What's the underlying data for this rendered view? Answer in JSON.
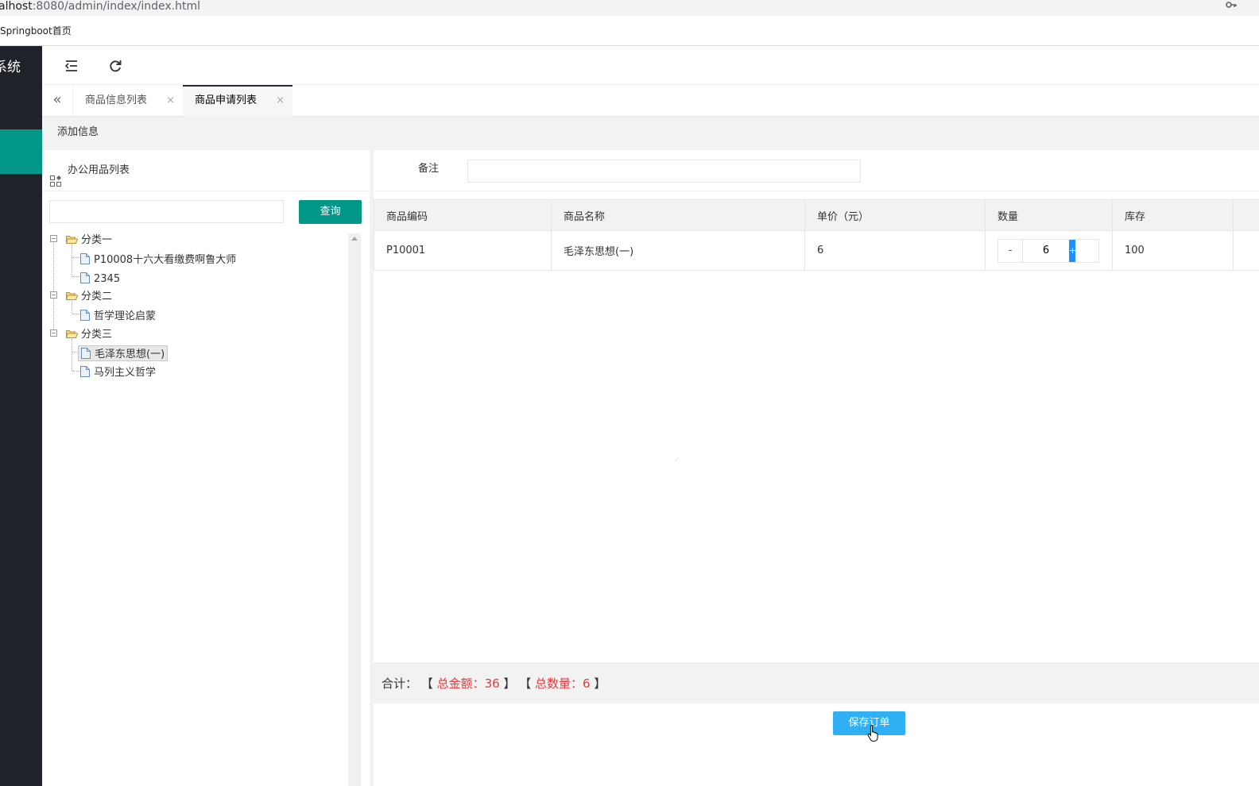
{
  "browser": {
    "url_host": "alhost",
    "url_rest": ":8080/admin/index/index.html",
    "bookmark": "Springboot首页"
  },
  "sidebar": {
    "logo_text": "系统"
  },
  "tabs": [
    {
      "label": "商品信息列表",
      "close": "×"
    },
    {
      "label": "商品申请列表",
      "close": "×"
    }
  ],
  "toolbar": {
    "add_label": "添加信息"
  },
  "left_panel": {
    "title": "办公用品列表",
    "search_placeholder": "",
    "search_button": "查询",
    "tree": [
      {
        "label": "分类一",
        "children": [
          "P10008十六大看缴费啊鲁大师",
          "2345"
        ]
      },
      {
        "label": "分类二",
        "children": [
          "哲学理论启蒙"
        ]
      },
      {
        "label": "分类三",
        "children": [
          "毛泽东思想(一)",
          "马列主义哲学"
        ]
      }
    ]
  },
  "form": {
    "remark_label": "备注",
    "remark_value": ""
  },
  "table": {
    "headers": [
      "商品编码",
      "商品名称",
      "单价（元）",
      "数量",
      "库存"
    ],
    "rows": [
      {
        "code": "P10001",
        "name": "毛泽东思想(一)",
        "price": "6",
        "qty": "6",
        "stock": "100"
      }
    ]
  },
  "stepper": {
    "minus": "-",
    "plus": "+"
  },
  "summary": {
    "prefix": "合计：",
    "open1": "【",
    "amount_text": " 总金额：36 ",
    "close1": "】",
    "open2": "【",
    "count_text": " 总数量：6 ",
    "close2": "】"
  },
  "save_button": "保存订单",
  "colors": {
    "primary": "#009688",
    "side_dark": "#20222a",
    "save_blue": "#2fb0f5",
    "total_red": "#e4393c"
  }
}
